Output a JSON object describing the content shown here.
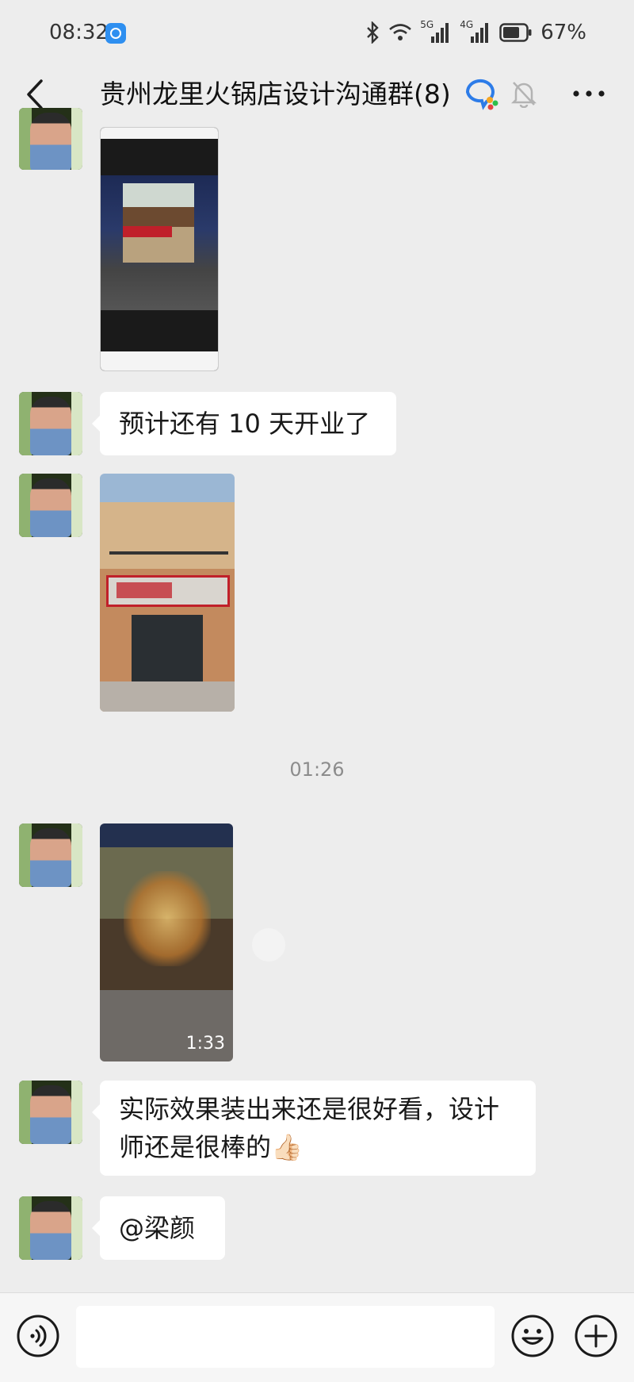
{
  "status_bar": {
    "time": "08:32",
    "network_1": "5G",
    "network_2": "4G",
    "battery": "67%",
    "icons": [
      "bluetooth-icon",
      "wifi-icon",
      "signal-5g-icon",
      "signal-4g-icon",
      "battery-icon"
    ]
  },
  "header": {
    "title": "贵州龙里火锅店设计沟通群(8)",
    "icons": [
      "back-icon",
      "wecom-icon",
      "mute-bell-icon",
      "more-icon"
    ]
  },
  "messages": [
    {
      "type": "image",
      "kind": "screenshot"
    },
    {
      "type": "text",
      "text": "预计还有 10 天开业了"
    },
    {
      "type": "image",
      "kind": "photo"
    },
    {
      "type": "time",
      "text": "01:26"
    },
    {
      "type": "video",
      "duration": "1:33"
    },
    {
      "type": "text",
      "text": "实际效果装出来还是很好看，设计师还是很棒的👍🏻"
    },
    {
      "type": "text",
      "text": "@梁颜"
    }
  ],
  "input_bar": {
    "placeholder": "",
    "icons": [
      "voice-icon",
      "emoji-icon",
      "plus-icon"
    ]
  },
  "colors": {
    "background": "#ededed",
    "bubble": "#ffffff",
    "timestamp": "#8c8c8c"
  }
}
